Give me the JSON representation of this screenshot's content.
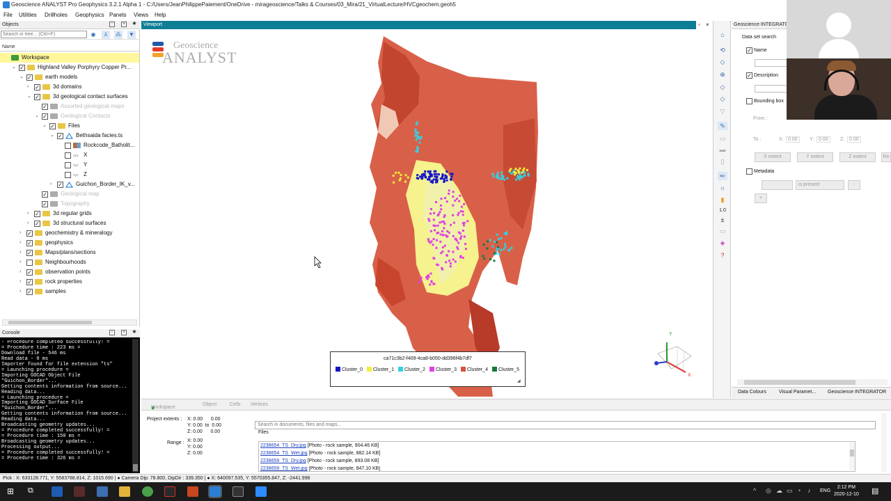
{
  "window": {
    "title": "Geoscience ANALYST Pro Geophysics 3.2.1 Alpha 1 - C:/Users/JeanPhilippePaiement/OneDrive - mirageoscience/Talks & Courses/03_Mira/21_VirtualLecture/HVCgeochem.geoh5"
  },
  "menu": [
    "File",
    "Utilities",
    "Drillholes",
    "Geophysics",
    "Panels",
    "Views",
    "Help"
  ],
  "objects_panel": {
    "title": "Objects",
    "search_placeholder": "Search in tree... (Ctrl+F)",
    "name_header": "Name",
    "tree": [
      {
        "label": "Workspace",
        "depth": 0,
        "expander": "",
        "checkbox": "",
        "icon": "workspace",
        "dim": false
      },
      {
        "label": "Highland Valley Porphyry Copper Pr...",
        "depth": 1,
        "expander": "v",
        "checkbox": "✓",
        "icon": "folder",
        "dim": false
      },
      {
        "label": "earth models",
        "depth": 2,
        "expander": "v",
        "checkbox": "✓",
        "icon": "folder",
        "dim": false
      },
      {
        "label": "3d domains",
        "depth": 3,
        "expander": ">",
        "checkbox": "✓",
        "icon": "folder",
        "dim": false
      },
      {
        "label": "3d geological contact surfaces",
        "depth": 3,
        "expander": "v",
        "checkbox": "✓",
        "icon": "folder",
        "dim": false
      },
      {
        "label": "Assorted geological maps",
        "depth": 4,
        "expander": "",
        "checkbox": "✓",
        "icon": "group",
        "dim": true
      },
      {
        "label": "Geological Contacts",
        "depth": 4,
        "expander": "v",
        "checkbox": "✓",
        "icon": "group",
        "dim": true
      },
      {
        "label": "Files",
        "depth": 5,
        "expander": "v",
        "checkbox": "✓",
        "icon": "folder",
        "dim": false
      },
      {
        "label": "Bethsaida facies.ts",
        "depth": 6,
        "expander": "v",
        "checkbox": "✓",
        "icon": "surface",
        "dim": false
      },
      {
        "label": "Rockcode_Batholit...",
        "depth": 7,
        "expander": "",
        "checkbox": "",
        "icon": "data",
        "dim": false
      },
      {
        "label": "X",
        "depth": 7,
        "expander": "",
        "checkbox": "",
        "icon": "xyz",
        "dim": false
      },
      {
        "label": "Y",
        "depth": 7,
        "expander": "",
        "checkbox": "",
        "icon": "xyz",
        "dim": false
      },
      {
        "label": "Z",
        "depth": 7,
        "expander": "",
        "checkbox": "",
        "icon": "xyz",
        "dim": false
      },
      {
        "label": "Guichon_Border_IK_v...",
        "depth": 6,
        "expander": ">",
        "checkbox": "✓",
        "icon": "surface",
        "dim": false
      },
      {
        "label": "Geological map",
        "depth": 4,
        "expander": "",
        "checkbox": "✓",
        "icon": "group",
        "dim": true
      },
      {
        "label": "Topography",
        "depth": 4,
        "expander": "",
        "checkbox": "✓",
        "icon": "group",
        "dim": true
      },
      {
        "label": "3d regular grids",
        "depth": 3,
        "expander": ">",
        "checkbox": "✓",
        "icon": "folder",
        "dim": false
      },
      {
        "label": "3d structural surfaces",
        "depth": 3,
        "expander": ">",
        "checkbox": "✓",
        "icon": "folder",
        "dim": false
      },
      {
        "label": "geochemistry & mineralogy",
        "depth": 2,
        "expander": ">",
        "checkbox": "✓",
        "icon": "folder",
        "dim": false
      },
      {
        "label": "geophysics",
        "depth": 2,
        "expander": ">",
        "checkbox": "✓",
        "icon": "folder",
        "dim": false
      },
      {
        "label": "Maps/plans/sections",
        "depth": 2,
        "expander": ">",
        "checkbox": "✓",
        "icon": "folder",
        "dim": false
      },
      {
        "label": "Neighbourhoods",
        "depth": 2,
        "expander": ">",
        "checkbox": "",
        "icon": "folder",
        "dim": false
      },
      {
        "label": "observation points",
        "depth": 2,
        "expander": ">",
        "checkbox": "✓",
        "icon": "folder",
        "dim": false
      },
      {
        "label": "rock properties",
        "depth": 2,
        "expander": ">",
        "checkbox": "✓",
        "icon": "folder",
        "dim": false
      },
      {
        "label": "samples",
        "depth": 2,
        "expander": ">",
        "checkbox": "✓",
        "icon": "folder",
        "dim": false
      }
    ]
  },
  "console": {
    "title": "Console",
    "lines": [
      "- Procedure completed successfully! =",
      "= Procedure time : 223 ms =",
      "Download file - 546 ms",
      "Read data - 0 ms",
      "Importer found for file extension \"ts\"",
      "= Launching procedure =",
      "Importing GOCAD Object File",
      "\"Guichon_Border\"...",
      "Getting contents information from source...",
      "Reading data...",
      "= Launching procedure =",
      "Importing GOCAD Surface File",
      "\"Guichon_Border\"...",
      "Getting contents information from source...",
      "Reading data...",
      "Broadcasting geometry updates...",
      "= Procedure completed successfully! =",
      "= Procedure time : 150 ms =",
      "Broadcasting geometry updates...",
      "Processing output...",
      "= Procedure completed successfully! =",
      "= Procedure time : 326 ms ="
    ]
  },
  "viewport": {
    "title": "Viewport",
    "logo_line1": "Geoscience",
    "logo_line2": "ANALYST",
    "legend_title": "ca71c3b2-f409-4ca8-b050-dd396f4b7df7",
    "clusters": [
      {
        "name": "Cluster_0",
        "color": "#1414c8"
      },
      {
        "name": "Cluster_1",
        "color": "#f2ee3a"
      },
      {
        "name": "Cluster_2",
        "color": "#34d0e0"
      },
      {
        "name": "Cluster_3",
        "color": "#e040e0"
      },
      {
        "name": "Cluster_4",
        "color": "#d85040"
      },
      {
        "name": "Cluster_5",
        "color": "#1a7a3a"
      }
    ]
  },
  "integrator": {
    "title": "Geoscience INTEGRATOR",
    "dataset_search": "Data set search",
    "name_label": "Name",
    "description_label": "Description",
    "bbox_label": "Bounding box",
    "from_label": "From :",
    "to_label": "To :",
    "x_label": "X:",
    "y_label": "Y:",
    "z_label": "Z:",
    "coord_values": [
      "0.00",
      "0.00",
      "0.00",
      "0.00",
      "0.00",
      "0.00"
    ],
    "extent_buttons": [
      "X extent",
      "Y extent",
      "Z extent",
      "Re"
    ],
    "metadata_label": "Metadata",
    "is_present": "is present",
    "add_button": "+",
    "remove_button": "-",
    "tabs": [
      "Data Colours",
      "Visual Paramet...",
      "Geoscience INTEGRATOR"
    ]
  },
  "bottom_panel": {
    "tabs": [
      "Workspace",
      "Object",
      "Cells",
      "Vertices"
    ],
    "project_extents_label": "Project extents :",
    "x_line": "X: 0.00      0.00",
    "y_line": "Y: 0.00  to  0.00",
    "z_line": "Z: 0.00      0.00",
    "range_label": "Range :",
    "range_x": "X: 0.00",
    "range_y": "Y: 0.00",
    "range_z": "Z: 0.00",
    "search_placeholder": "Search in documents, files and maps...",
    "files_label": "Files",
    "files": [
      {
        "link": "2238654_TS_Dry.jpg",
        "desc": "[Photo - rock sample, 904.46 KB]"
      },
      {
        "link": "2238654_TS_Wet.jpg",
        "desc": "[Photo - rock sample, 882.14 KB]"
      },
      {
        "link": "2238659_TS_Dry.jpg",
        "desc": "[Photo - rock sample, 893.08 KB]"
      },
      {
        "link": "2238659_TS_Wet.jpg",
        "desc": "[Photo - rock sample, 847.10 KB]"
      }
    ]
  },
  "status_bar": "Pick : X: 633128.771, Y: 5583788.814, Z: 1015.690 | ● Camera Dip: 78.800, DipDir : 339.350 | ● X: 640097.535, Y: 5570355.847, Z: -2441.996",
  "taskbar": {
    "lang": "ENG",
    "time": "2:12 PM",
    "date": "2020-12-10"
  }
}
